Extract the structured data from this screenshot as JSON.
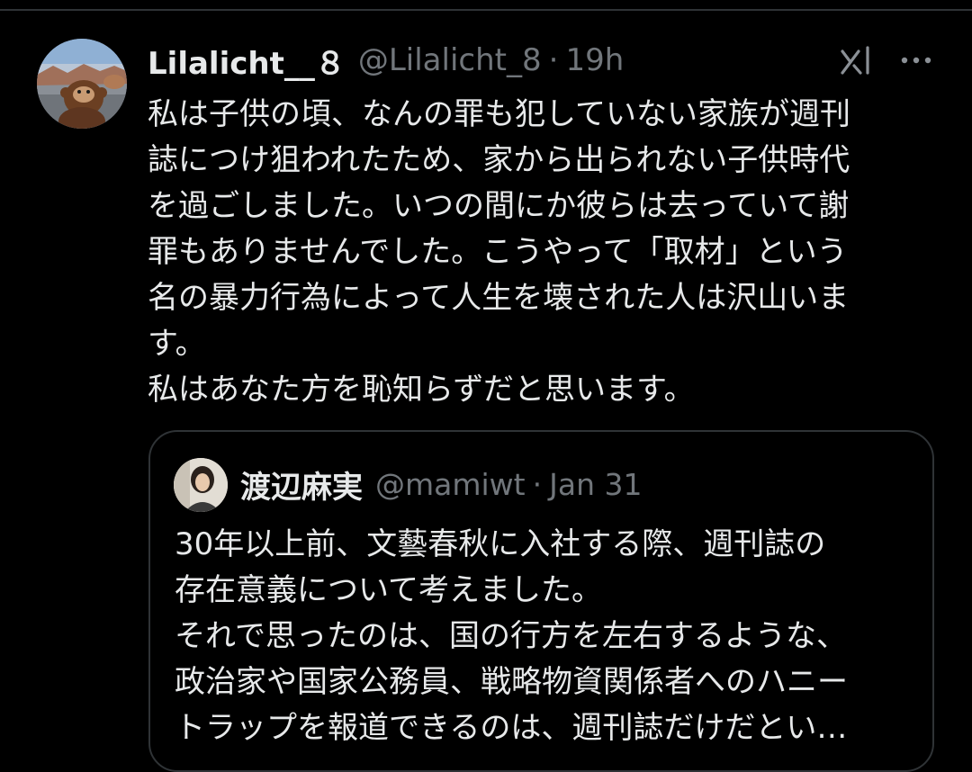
{
  "tweet": {
    "author": {
      "display_name": "Lilalicht__８",
      "handle": "@Lilalicht_8",
      "time": "19h",
      "separator": "·"
    },
    "text_lines": [
      "私は子供の頃、なんの罪も犯していない家族が週刊",
      "誌につけ狙われたため、家から出られない子供時代",
      "を過ごしました。いつの間にか彼らは去っていて謝",
      "罪もありませんでした。こうやって「取材」という",
      "名の暴力行為によって人生を壊された人は沢山いま",
      "す。",
      "私はあなた方を恥知らずだと思います。"
    ],
    "icons": {
      "grok": "grok-icon",
      "more": "more-icon"
    }
  },
  "quoted": {
    "author": {
      "display_name": "渡辺麻実",
      "handle": "@mamiwt",
      "date": "Jan 31",
      "separator": "·"
    },
    "text_lines": [
      "30年以上前、文藝春秋に入社する際、週刊誌の",
      "存在意義について考えました。",
      "それで思ったのは、国の行方を左右するような、",
      "政治家や国家公務員、戦略物資関係者へのハニー",
      "トラップを報道できるのは、週刊誌だけだとい…"
    ]
  },
  "colors": {
    "background": "#000000",
    "primary_text": "#e7e9ea",
    "secondary_text": "#71767b",
    "border": "#2f3336"
  }
}
